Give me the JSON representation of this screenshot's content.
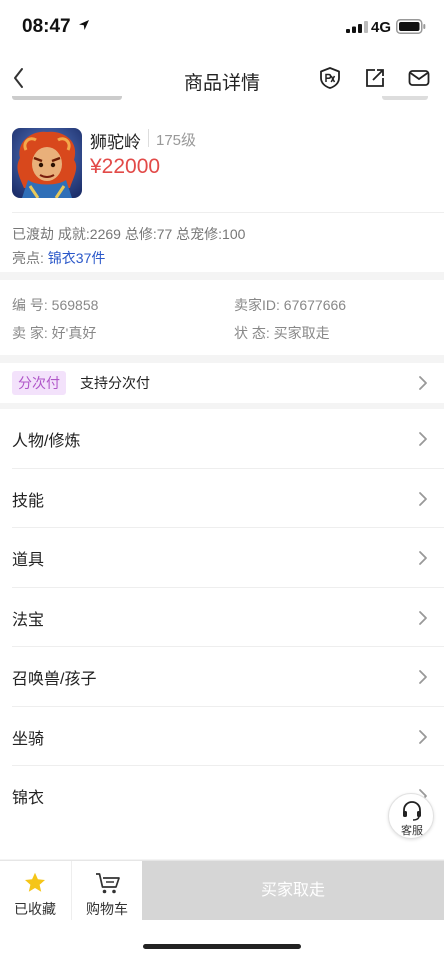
{
  "status_bar": {
    "time": "08:47",
    "network": "4G"
  },
  "nav": {
    "title": "商品详情",
    "icons": [
      "back-icon",
      "px-badge-icon",
      "share-icon",
      "mail-icon"
    ]
  },
  "product": {
    "name": "狮驼岭",
    "level": "175级",
    "price": "¥22000",
    "stats": "已渡劫 成就:2269 总修:77 总宠修:100",
    "highlight_label": "亮点:",
    "highlight_value": "锦衣37件"
  },
  "info": {
    "id_label": "编 号:",
    "id_value": "569858",
    "seller_id_label": "卖家ID:",
    "seller_id_value": "67677666",
    "seller_label": "卖 家:",
    "seller_value": "好'真好",
    "status_label": "状 态:",
    "status_value": "买家取走"
  },
  "installment": {
    "tag": "分次付",
    "text": "支持分次付"
  },
  "sections": [
    {
      "label": "人物/修炼"
    },
    {
      "label": "技能"
    },
    {
      "label": "道具"
    },
    {
      "label": "法宝"
    },
    {
      "label": "召唤兽/孩子"
    },
    {
      "label": "坐骑"
    },
    {
      "label": "锦衣"
    }
  ],
  "service": {
    "label": "客服"
  },
  "bottom_bar": {
    "favorite_label": "已收藏",
    "cart_label": "购物车",
    "action_label": "买家取走"
  },
  "colors": {
    "price": "#e24a48",
    "link": "#2b58c9",
    "tag_text": "#b057c9",
    "tag_bg": "#f3e2fb",
    "star": "#f5c518",
    "action_bg": "#d6d6d6"
  }
}
